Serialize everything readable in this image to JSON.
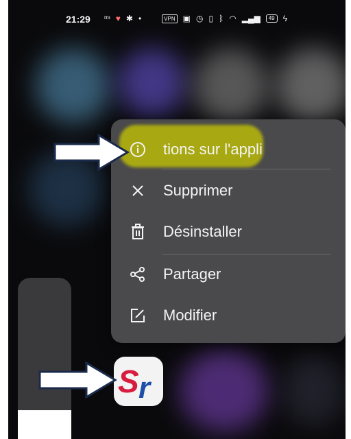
{
  "status_bar": {
    "time": "21:29",
    "left_icons": [
      "notification-icon",
      "heart-icon",
      "bug-icon",
      "dot-icon"
    ],
    "vpn_label": "VPN",
    "right_icons": [
      "nfc-icon",
      "alarm-icon",
      "vibrate-icon",
      "bluetooth-icon",
      "wifi-icon",
      "signal-icon"
    ],
    "battery_label": "49"
  },
  "context_menu": {
    "items": [
      {
        "label": "tions sur l'appli",
        "icon": "info-icon",
        "highlighted": true
      },
      {
        "label": "Supprimer",
        "icon": "close-icon"
      },
      {
        "label": "Désinstaller",
        "icon": "trash-icon"
      },
      {
        "label": "Partager",
        "icon": "share-icon"
      },
      {
        "label": "Modifier",
        "icon": "edit-icon"
      }
    ]
  },
  "app": {
    "icon_text_s": "S",
    "icon_text_r": "r",
    "brand_red": "#d81c3f",
    "brand_blue": "#1f4fa8"
  },
  "colors": {
    "menu_bg": "#4a4a4c",
    "highlight": "#c8c800",
    "arrow": "#ffffff"
  }
}
